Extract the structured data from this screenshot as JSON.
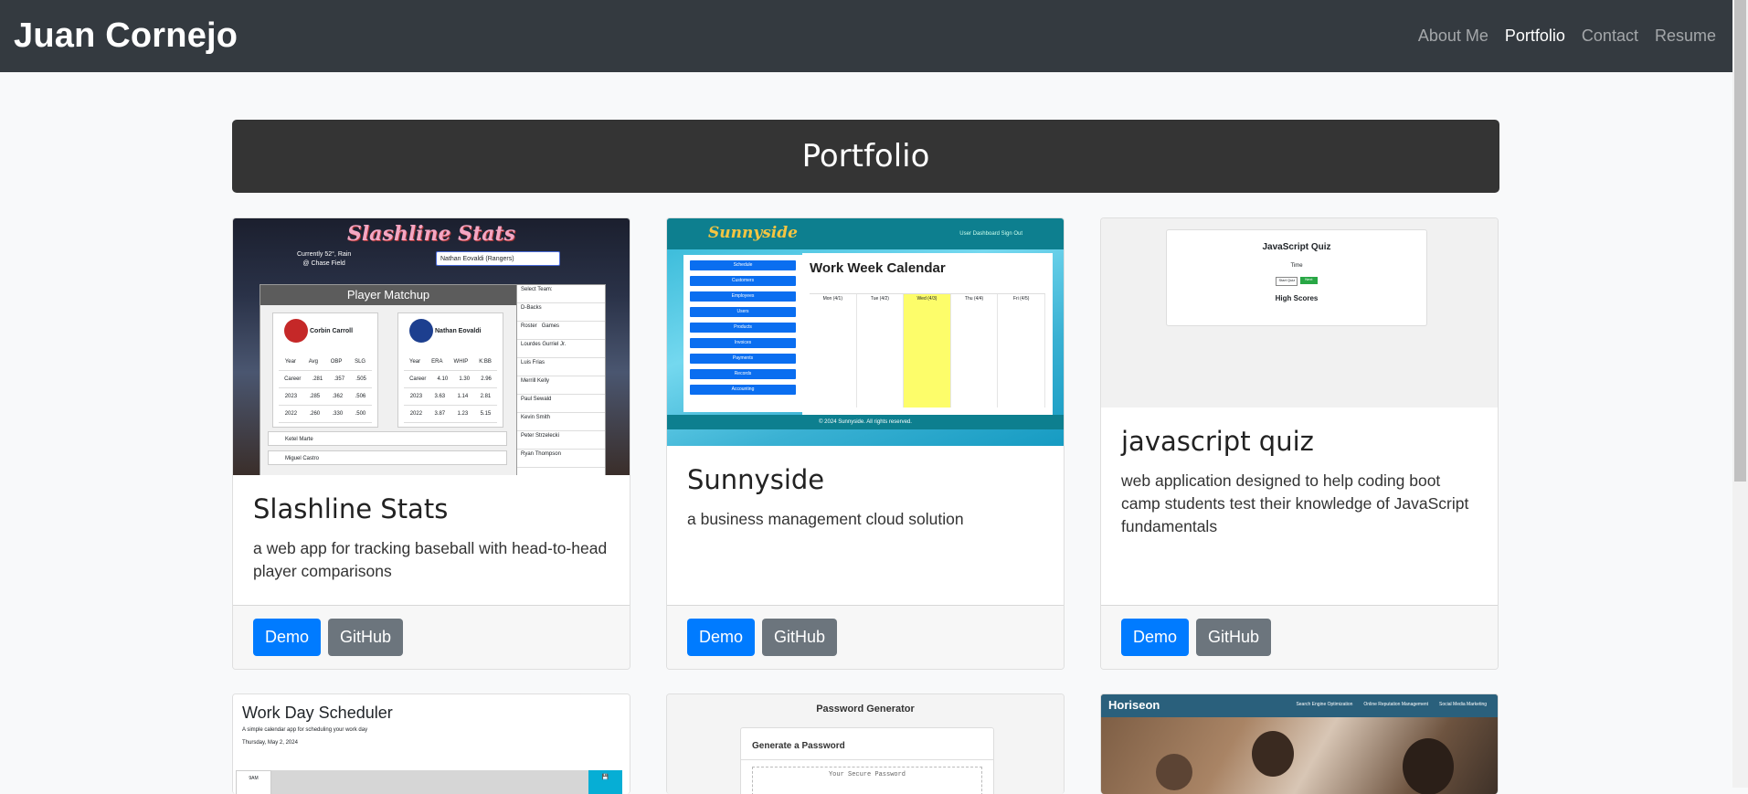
{
  "navbar": {
    "brand": "Juan Cornejo",
    "links": [
      "About Me",
      "Portfolio",
      "Contact",
      "Resume"
    ],
    "active": "Portfolio"
  },
  "banner": {
    "title": "Portfolio"
  },
  "buttons": {
    "demo": "Demo",
    "github": "GitHub"
  },
  "projects": [
    {
      "title": "Slashline Stats",
      "description": "a web app for tracking baseball with head-to-head player comparisons",
      "screenshot": {
        "app_title": "Slashline Stats",
        "weather": "Currently 52°, Rain",
        "venue": "@ Chase Field",
        "search_value": "Nathan Eovaldi (Rangers)",
        "panel_title": "Player Matchup",
        "player_left": "Corbin Carroll",
        "player_right": "Nathan Eovaldi",
        "left_headers": [
          "Year",
          "Avg",
          "OBP",
          "SLG"
        ],
        "left_rows": [
          [
            "Career",
            ".281",
            ".357",
            ".505"
          ],
          [
            "2023",
            ".285",
            ".362",
            ".506"
          ],
          [
            "2022",
            ".260",
            ".330",
            ".500"
          ]
        ],
        "right_headers": [
          "Year",
          "ERA",
          "WHIP",
          "K:BB"
        ],
        "right_rows": [
          [
            "Career",
            "4.10",
            "1.30",
            "2.96"
          ],
          [
            "2023",
            "3.63",
            "1.14",
            "2.81"
          ],
          [
            "2022",
            "3.87",
            "1.23",
            "5.15"
          ]
        ],
        "team_label": "Select Team:",
        "team_value": "D-Backs",
        "side_tabs": [
          "Roster",
          "Games"
        ],
        "roster": [
          "Lourdes Gurriel Jr.",
          "Luis Frias",
          "Merrill Kelly",
          "Paul Sewald",
          "Kevin Smith",
          "Peter Strzelecki",
          "Ryan Thompson"
        ],
        "bottom_players": [
          "Ketel Marte",
          "Miguel Castro"
        ]
      }
    },
    {
      "title": "Sunnyside",
      "description": "a business management cloud solution",
      "screenshot": {
        "logo": "Sunnyside",
        "nav": "User Dashboard   Sign Out",
        "menu": [
          "Schedule",
          "Customers",
          "Employees",
          "Users",
          "Products",
          "Invoices",
          "Payments",
          "Records",
          "Accounting"
        ],
        "calendar_title": "Work Week Calendar",
        "days": [
          "Mon (4/1)",
          "Tue (4/2)",
          "Wed (4/3)",
          "Thu (4/4)",
          "Fri (4/5)"
        ],
        "footer": "© 2024 Sunnyside. All rights reserved."
      }
    },
    {
      "title": "javascript quiz",
      "description": "web application designed to help coding boot camp students test their knowledge of JavaScript fundamentals",
      "screenshot": {
        "title": "JavaScript Quiz",
        "timer": "Time",
        "start": "Start Quiz",
        "next": "Next",
        "high_scores": "High Scores"
      }
    },
    {
      "title": "Work Day Scheduler",
      "screenshot": {
        "title": "Work Day Scheduler",
        "subtitle": "A simple calendar app for scheduling your work day",
        "date": "Thursday, May 2, 2024",
        "hour": "9AM"
      }
    },
    {
      "title": "Password Generator",
      "screenshot": {
        "title": "Password Generator",
        "card_title": "Generate a Password",
        "placeholder": "Your Secure Password"
      }
    },
    {
      "title": "Horiseon",
      "screenshot": {
        "logo": "Horiseon",
        "nav": [
          "Search Engine Optimization",
          "Online Reputation Management",
          "Social Media Marketing"
        ]
      }
    }
  ]
}
